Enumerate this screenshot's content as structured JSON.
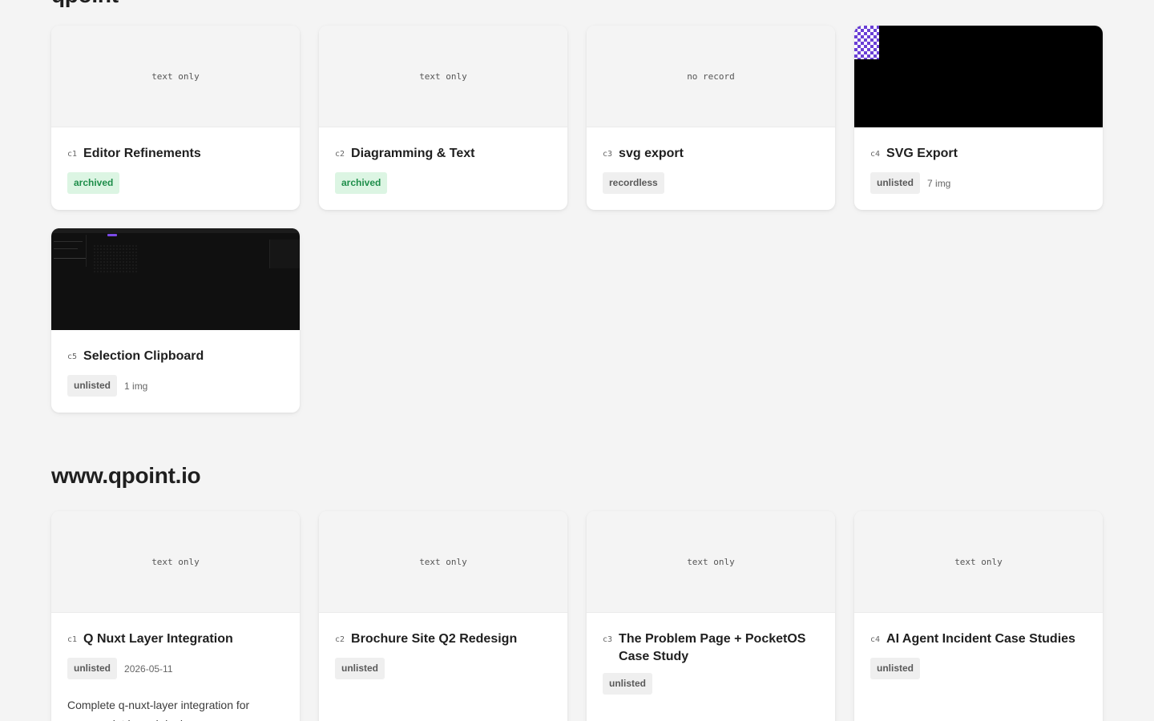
{
  "sections": {
    "section1": {
      "title": "qpoint"
    },
    "section2": {
      "title": "www.qpoint.io"
    }
  },
  "cards1": [
    {
      "id": "c1",
      "title": "Editor Refinements",
      "thumb": "text only",
      "status": "archived"
    },
    {
      "id": "c2",
      "title": "Diagramming & Text",
      "thumb": "text only",
      "status": "archived"
    },
    {
      "id": "c3",
      "title": "svg export",
      "thumb": "no record",
      "status": "recordless"
    },
    {
      "id": "c4",
      "title": "SVG Export",
      "status": "unlisted",
      "extra": "7 img"
    },
    {
      "id": "c5",
      "title": "Selection Clipboard",
      "status": "unlisted",
      "extra": "1 img"
    }
  ],
  "cards2": [
    {
      "id": "c1",
      "title": "Q Nuxt Layer Integration",
      "thumb": "text only",
      "status": "unlisted",
      "extra": "2026-05-11",
      "desc": "Complete q-nuxt-layer integration for www.qpoint.io and deploy"
    },
    {
      "id": "c2",
      "title": "Brochure Site Q2 Redesign",
      "thumb": "text only",
      "status": "unlisted"
    },
    {
      "id": "c3",
      "title": "The Problem Page + PocketOS Case Study",
      "thumb": "text only",
      "status": "unlisted"
    },
    {
      "id": "c4",
      "title": "AI Agent Incident Case Studies",
      "thumb": "text only",
      "status": "unlisted"
    }
  ],
  "colors": {
    "background": "#f4f4f4",
    "archived_bg": "#dcf5e3",
    "archived_fg": "#1e8e4a",
    "badge_gray_bg": "#efefef",
    "accent_purple": "#6a3fd6"
  }
}
